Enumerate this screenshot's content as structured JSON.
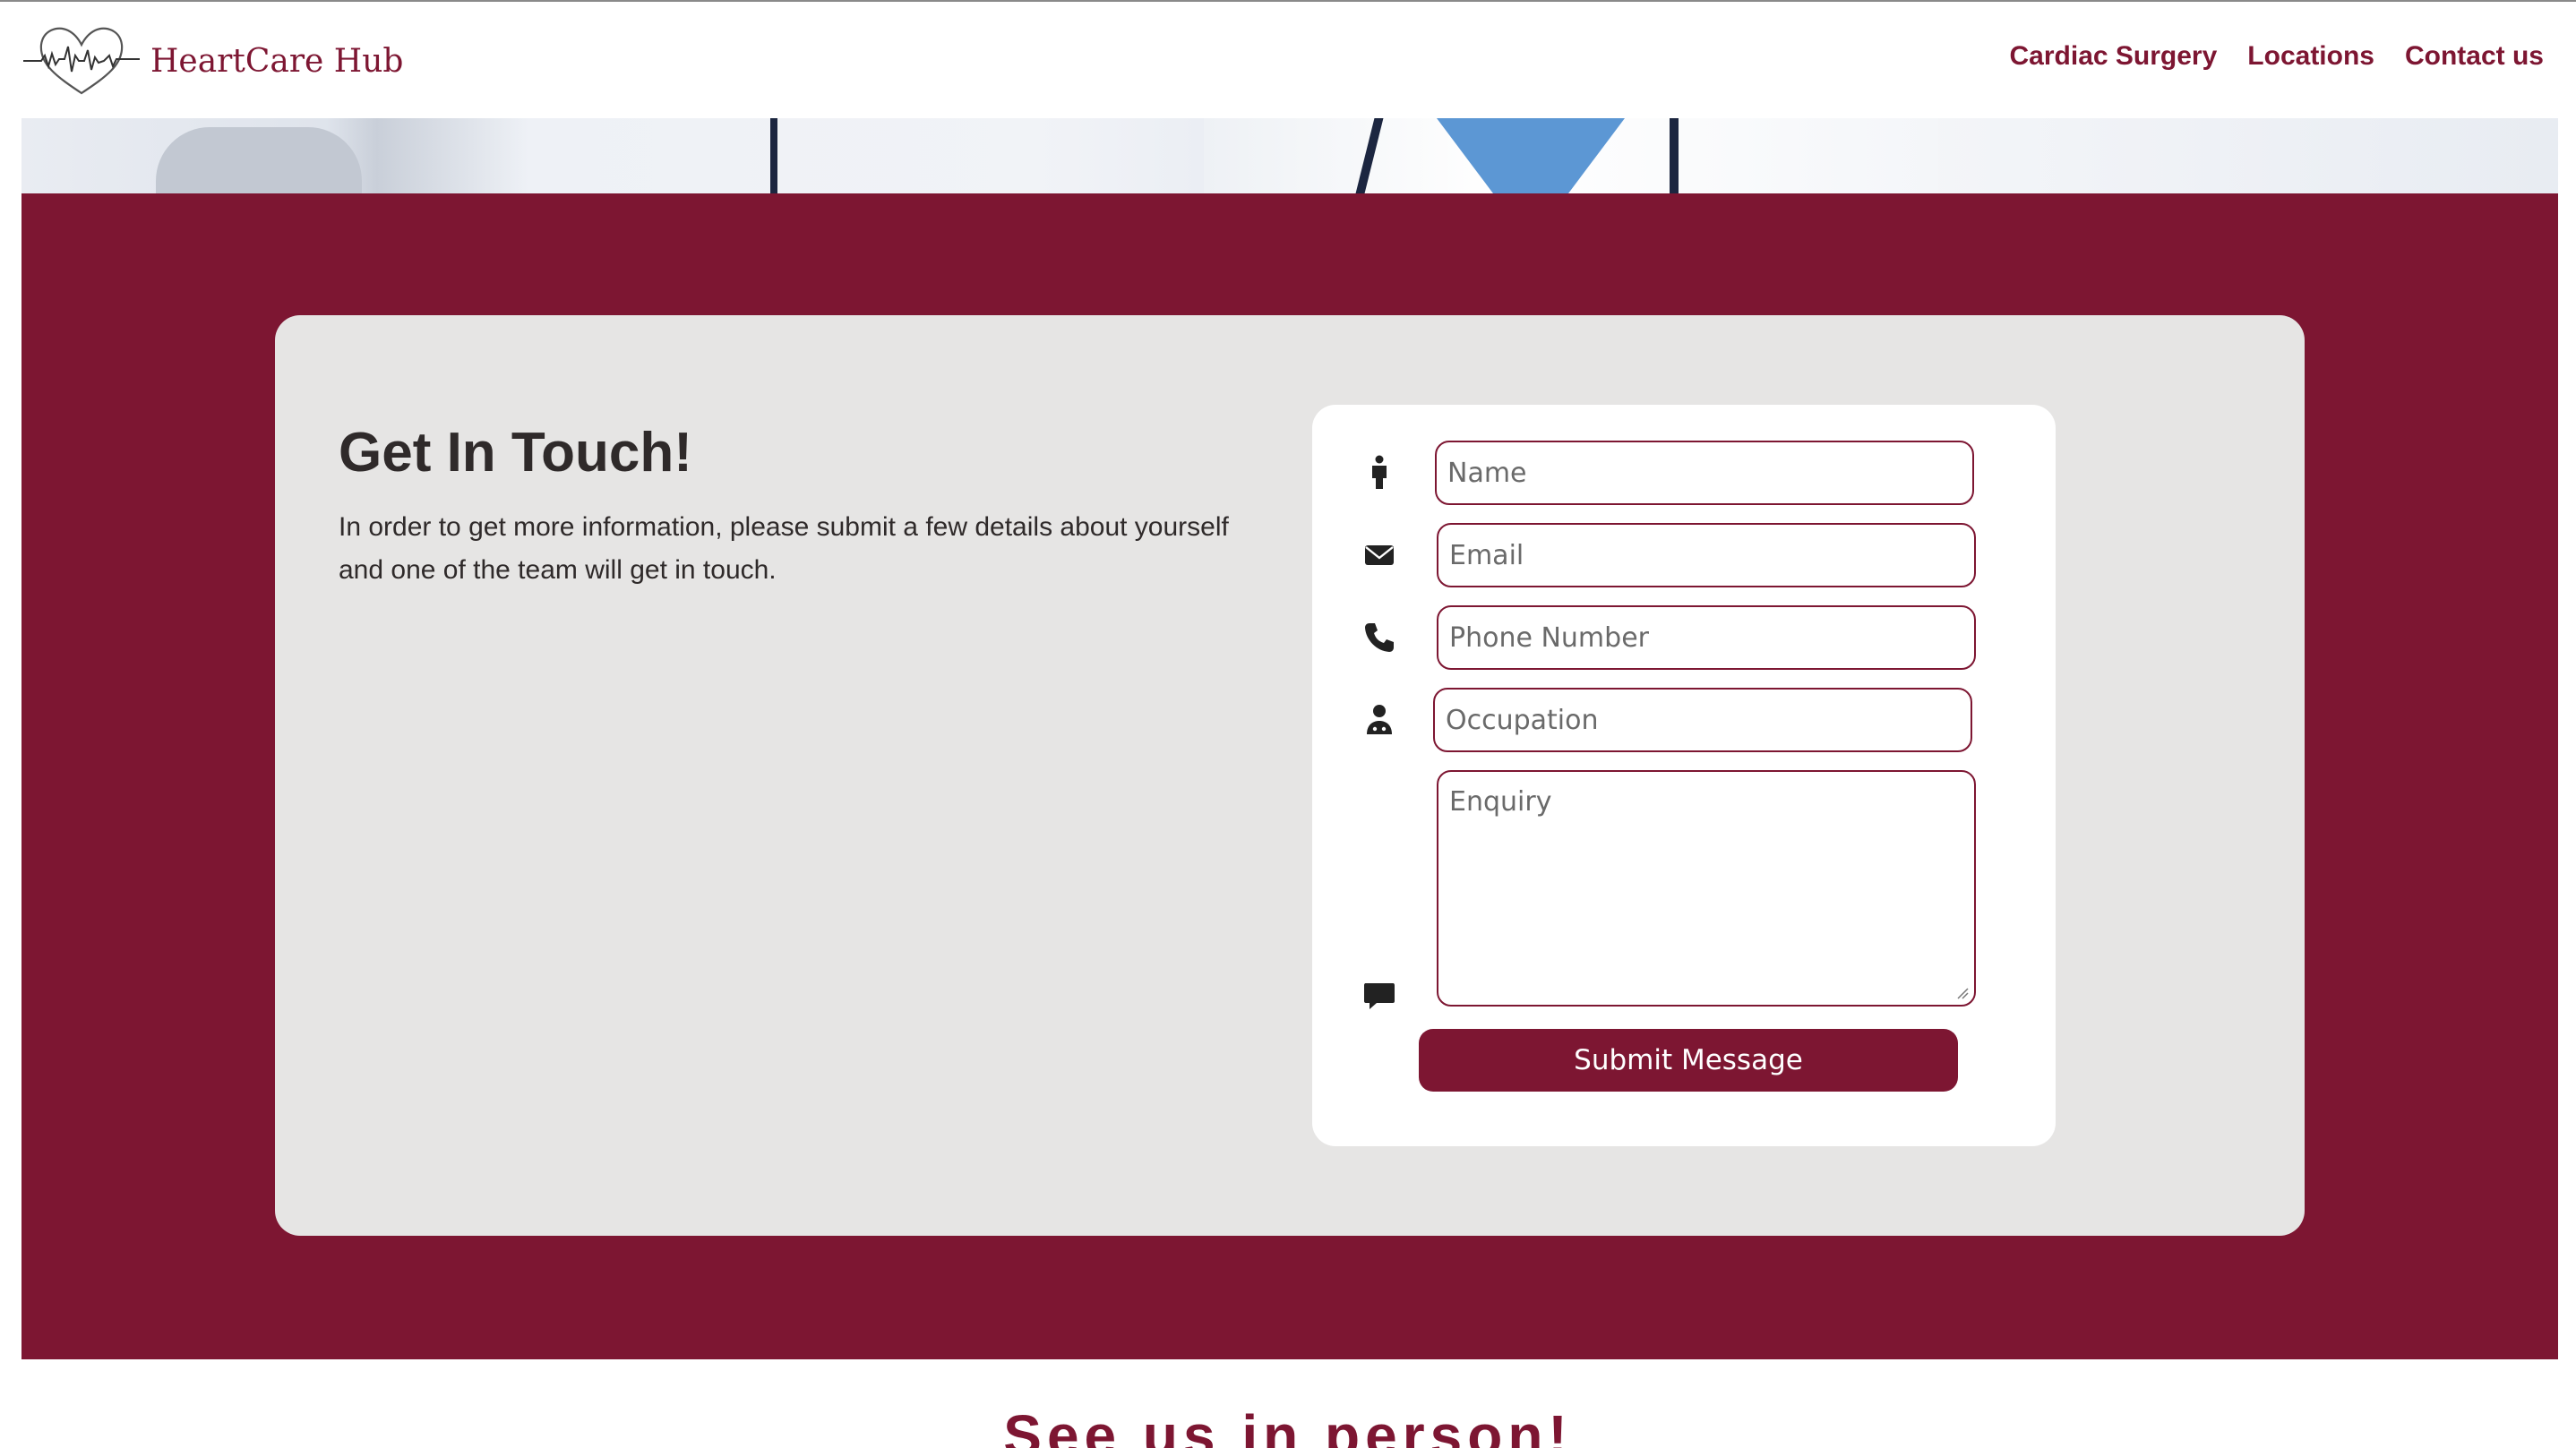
{
  "brand": {
    "name": "HeartCare Hub",
    "logo_icon": "heart-ecg-icon",
    "color": "#7d1632"
  },
  "nav": {
    "items": [
      {
        "label": "Cardiac Surgery"
      },
      {
        "label": "Locations"
      },
      {
        "label": "Contact us"
      }
    ]
  },
  "contact": {
    "heading": "Get In Touch!",
    "description": "In order to get more information, please submit a few details about yourself and one of the team will get in touch.",
    "fields": {
      "name": {
        "placeholder": "Name",
        "icon": "person-icon"
      },
      "email": {
        "placeholder": "Email",
        "icon": "envelope-icon"
      },
      "phone": {
        "placeholder": "Phone Number",
        "icon": "phone-icon"
      },
      "occupation": {
        "placeholder": "Occupation",
        "icon": "doctor-icon"
      },
      "enquiry": {
        "placeholder": "Enquiry",
        "icon": "comment-icon"
      }
    },
    "submit_label": "Submit Message"
  },
  "next_section": {
    "heading": "See us in person!"
  },
  "colors": {
    "accent": "#7d1632",
    "card_bg": "#e6e5e4",
    "form_bg": "#ffffff",
    "text": "#2f2a2a"
  }
}
